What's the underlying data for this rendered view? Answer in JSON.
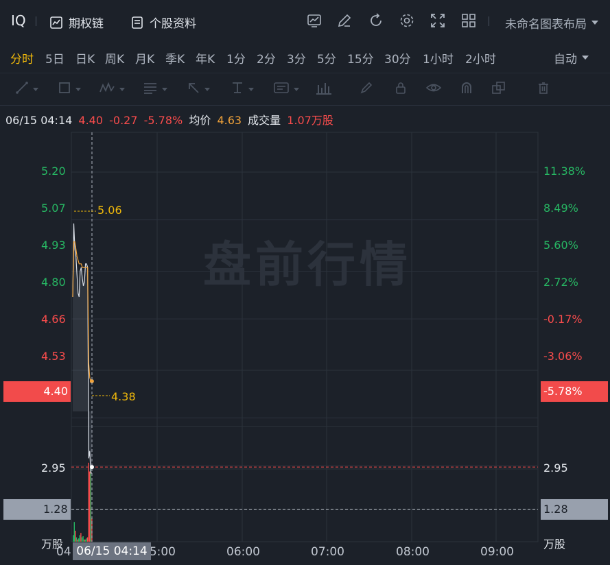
{
  "header": {
    "symbol": "IQ",
    "options_chain": "期权链",
    "stock_profile": "个股资料",
    "icons": [
      "chart-icon",
      "edit-icon",
      "refresh-icon",
      "settings-icon",
      "fullscreen-icon",
      "grid-layout-icon"
    ],
    "layout_label": "未命名图表布局"
  },
  "periods": {
    "items": [
      "分时",
      "5日",
      "日K",
      "周K",
      "月K",
      "季K",
      "年K",
      "1分",
      "2分",
      "3分",
      "5分",
      "15分",
      "30分",
      "1小时",
      "2小时"
    ],
    "active": "分时",
    "auto_label": "自动"
  },
  "drawing_tools": [
    "line-tool-icon",
    "rect-tool-icon",
    "pattern-tool-icon",
    "fib-tool-icon",
    "arrow-tool-icon",
    "measure-tool-icon",
    "text-tool-icon",
    "indicator-tool-icon",
    "brush-icon",
    "lock-icon",
    "eye-icon",
    "magnet-icon",
    "copy-icon",
    "trash-icon"
  ],
  "info": {
    "datetime": "06/15 04:14",
    "price": "4.40",
    "change": "-0.27",
    "change_pct": "-5.78%",
    "avg_label": "均价",
    "avg_value": "4.63",
    "volume_label": "成交量",
    "volume_value": "1.07万股"
  },
  "watermark": "盘前行情",
  "colors": {
    "background": "#1c2129",
    "up": "#27b763",
    "down": "#f84c4c",
    "avg_line": "#f2a33a",
    "highlight": "#f0b90b"
  },
  "chart_data": {
    "type": "line",
    "price_axis_left": [
      "5.20",
      "5.07",
      "4.93",
      "4.80",
      "4.66",
      "4.53",
      "4.40"
    ],
    "price_axis_right": [
      "11.38%",
      "8.49%",
      "5.60%",
      "2.72%",
      "-0.17%",
      "-3.06%",
      "-5.78%"
    ],
    "price_ticks": [
      5.2,
      5.07,
      4.93,
      4.8,
      4.66,
      4.53,
      4.4
    ],
    "current_price_label": "4.40",
    "current_pct_label": "-5.78%",
    "high_marker": "5.06",
    "low_marker": "4.38",
    "volume_axis_left": [
      "2.95",
      "1.28"
    ],
    "volume_axis_right": [
      "2.95"
    ],
    "volume_cursor_label": "1.28",
    "volume_unit": "万股",
    "time_labels": [
      "04",
      "05:00",
      "06:00",
      "07:00",
      "08:00",
      "09:00"
    ],
    "cursor_time": "06/15 04:14",
    "price_series": [
      4.86,
      5.06,
      4.99,
      4.97,
      4.92,
      4.87,
      4.86,
      4.93,
      4.94,
      4.91,
      4.89,
      4.9,
      4.95,
      4.95,
      4.94,
      4.42,
      4.44,
      4.38,
      4.38
    ],
    "avg_series": [
      4.86,
      5.01,
      5.01,
      4.99,
      4.97,
      4.96,
      4.95,
      4.95,
      4.95,
      4.94,
      4.94,
      4.94,
      4.94,
      4.94,
      4.94,
      4.68,
      4.64,
      4.63,
      4.63
    ],
    "volume_series": [
      0.3,
      0.9,
      0.5,
      0.2,
      0.1,
      0.15,
      0.3,
      0.4,
      0.2,
      0.25,
      0.1,
      0.1,
      0.15,
      0.2,
      3.6,
      3.2,
      3.4,
      1.07
    ],
    "volume_up": [
      1,
      1,
      0,
      1,
      0,
      1,
      1,
      0,
      1,
      1,
      0,
      1,
      1,
      0,
      0,
      0,
      1,
      0
    ]
  }
}
